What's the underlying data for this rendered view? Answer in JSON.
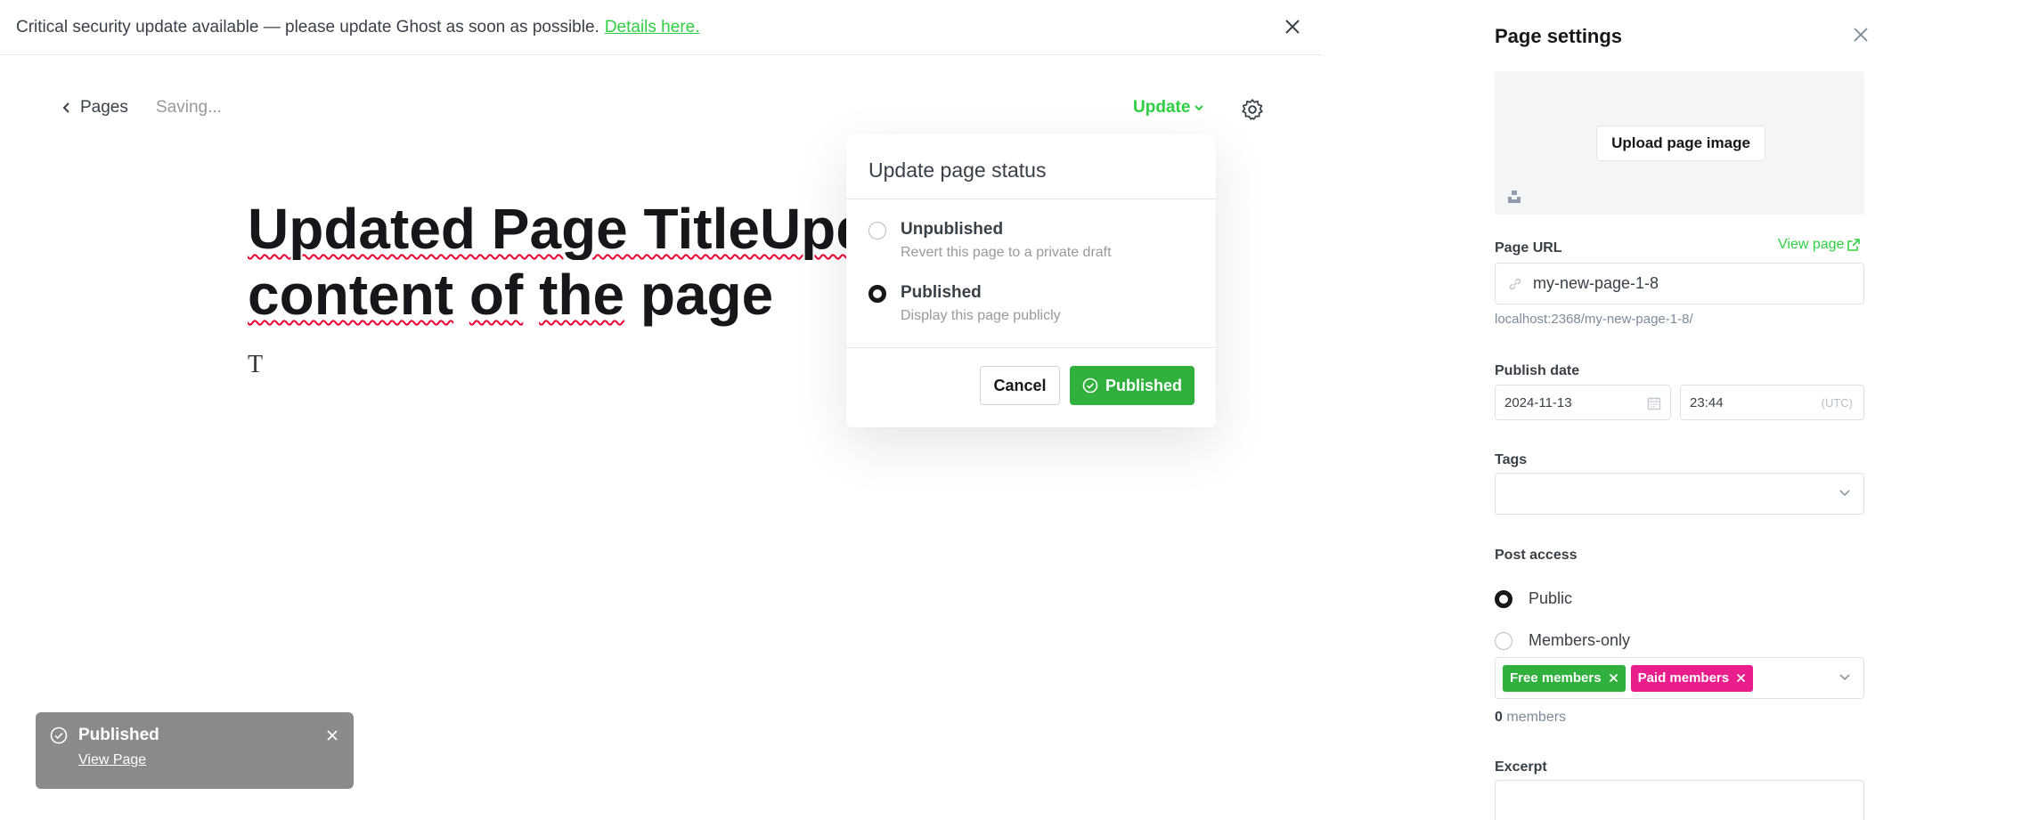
{
  "banner": {
    "message": "Critical security update available — please update Ghost as soon as possible.",
    "link": "Details here."
  },
  "editor": {
    "back_label": "Pages",
    "status": "Saving...",
    "update_label": "Update",
    "title_line1": "Updated Page TitleUpdat",
    "title_line2_words": [
      "content",
      "of",
      "the",
      "page"
    ],
    "body_text": "T"
  },
  "popup": {
    "title": "Update page status",
    "options": [
      {
        "label": "Unpublished",
        "desc": "Revert this page to a private draft",
        "selected": false
      },
      {
        "label": "Published",
        "desc": "Display this page publicly",
        "selected": true
      }
    ],
    "cancel_label": "Cancel",
    "confirm_label": "Published"
  },
  "toast": {
    "title": "Published",
    "link": "View Page"
  },
  "settings": {
    "title": "Page settings",
    "upload_label": "Upload page image",
    "url_label": "Page URL",
    "view_page_label": "View page",
    "url_value": "my-new-page-1-8",
    "url_hint": "localhost:2368/my-new-page-1-8/",
    "publish_date_label": "Publish date",
    "date_value": "2024-11-13",
    "time_value": "23:44",
    "timezone": "(UTC)",
    "tags_label": "Tags",
    "post_access_label": "Post access",
    "access_options": [
      {
        "label": "Public",
        "selected": true
      },
      {
        "label": "Members-only",
        "selected": false
      }
    ],
    "tiers": [
      {
        "label": "Free members",
        "color": "#30b03c"
      },
      {
        "label": "Paid members",
        "color": "#e91e8c"
      }
    ],
    "members_count": "0",
    "members_suffix": "members",
    "excerpt_label": "Excerpt"
  },
  "colors": {
    "accent": "#30cf43",
    "publish_green": "#30b03c",
    "paid_pink": "#e91e8c"
  }
}
